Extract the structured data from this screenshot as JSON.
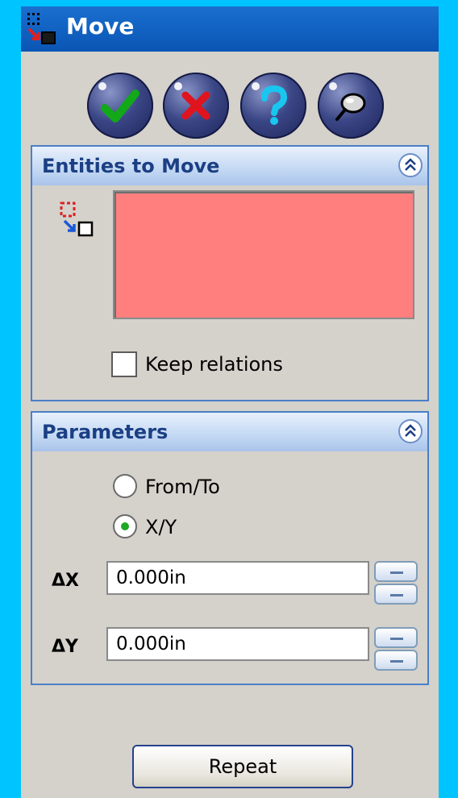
{
  "window": {
    "title": "Move"
  },
  "actions": {
    "ok": "ok-icon",
    "cancel": "cancel-icon",
    "help": "help-icon",
    "detailed_preview": "pushpin-icon"
  },
  "entities_group": {
    "title": "Entities to Move",
    "selection_box_color": "#ff7f7f",
    "keep_relations_label": "Keep relations",
    "keep_relations_checked": false
  },
  "parameters_group": {
    "title": "Parameters",
    "options": [
      {
        "label": "From/To",
        "selected": false
      },
      {
        "label": "X/Y",
        "selected": true
      }
    ],
    "delta_x": {
      "symbol": "Δ",
      "axis": "X",
      "value": "0.000in"
    },
    "delta_y": {
      "symbol": "Δ",
      "axis": "Y",
      "value": "0.000in"
    }
  },
  "footer": {
    "repeat_label": "Repeat"
  },
  "colors": {
    "background": "#00c4ff",
    "title_bar": "#0a55b4",
    "group_border": "#4a7fc8",
    "group_title": "#1b3f84"
  }
}
